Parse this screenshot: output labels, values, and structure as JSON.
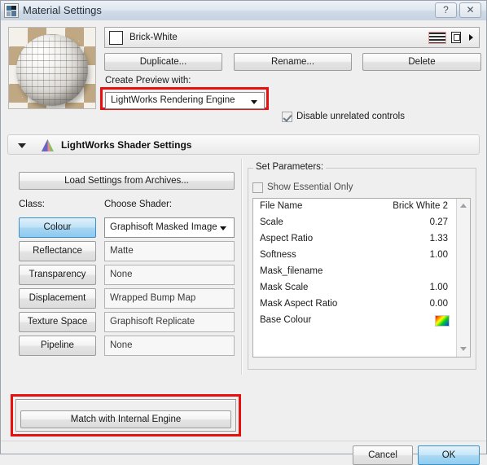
{
  "window": {
    "title": "Material Settings",
    "app_icon": "material-app-icon",
    "help_button": "?",
    "close_button": "✕"
  },
  "preview": {
    "alt": "material-preview-sphere"
  },
  "material": {
    "name": "Brick-White",
    "swatch_color": "#ffffff",
    "texture_icon": "brick-pattern-icon",
    "document_icon": "document-icon",
    "expand_icon": "expand-arrow-icon",
    "buttons": {
      "duplicate": "Duplicate...",
      "rename": "Rename...",
      "delete": "Delete"
    }
  },
  "create_preview": {
    "label": "Create Preview with:",
    "engine": "LightWorks Rendering Engine",
    "highlight_color": "#e8100f",
    "disable_unrelated": {
      "label": "Disable unrelated controls",
      "checked": true
    }
  },
  "shader_group": {
    "title": "LightWorks Shader Settings",
    "expanded": true
  },
  "left_panel": {
    "load_settings": "Load Settings from Archives...",
    "class_label": "Class:",
    "shader_label": "Choose Shader:",
    "rows": [
      {
        "class": "Colour",
        "shader": "Graphisoft Masked Image",
        "selected": true,
        "dropdown": true
      },
      {
        "class": "Reflectance",
        "shader": "Matte",
        "selected": false,
        "dropdown": false
      },
      {
        "class": "Transparency",
        "shader": "None",
        "selected": false,
        "dropdown": false
      },
      {
        "class": "Displacement",
        "shader": "Wrapped Bump Map",
        "selected": false,
        "dropdown": false
      },
      {
        "class": "Texture Space",
        "shader": "Graphisoft Replicate",
        "selected": false,
        "dropdown": false
      },
      {
        "class": "Pipeline",
        "shader": "None",
        "selected": false,
        "dropdown": false
      }
    ]
  },
  "right_panel": {
    "group_label": "Set Parameters:",
    "show_essential": {
      "label": "Show Essential Only",
      "checked": false
    },
    "parameters": [
      {
        "name": "File Name",
        "value": "Brick White 2"
      },
      {
        "name": "Scale",
        "value": "0.27"
      },
      {
        "name": "Aspect Ratio",
        "value": "1.33"
      },
      {
        "name": "Softness",
        "value": "1.00"
      },
      {
        "name": "Mask_filename",
        "value": ""
      },
      {
        "name": "Mask Scale",
        "value": "1.00"
      },
      {
        "name": "Mask Aspect Ratio",
        "value": "0.00"
      },
      {
        "name": "Base Colour",
        "value": "",
        "swatch": "rainbow"
      }
    ]
  },
  "match": {
    "label": "Match with Internal Engine",
    "highlight_color": "#e8100f"
  },
  "footer": {
    "cancel": "Cancel",
    "ok": "OK"
  }
}
